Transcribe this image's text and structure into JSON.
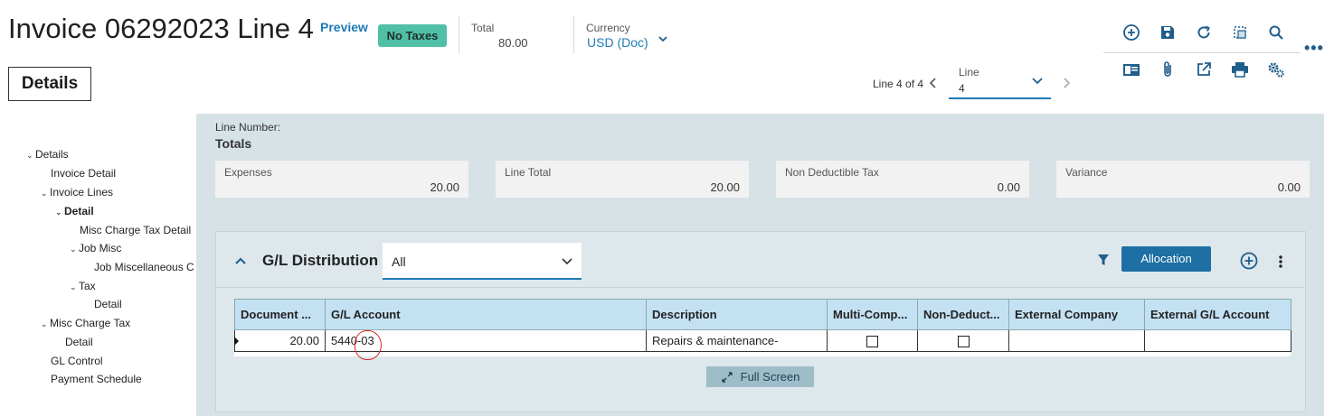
{
  "header": {
    "title": "Invoice 06292023 Line 4",
    "preview_link": "Preview",
    "tax_badge": "No Taxes",
    "total_label": "Total",
    "total_value": "80.00",
    "currency_label": "Currency",
    "currency_value": "USD (Doc)"
  },
  "toolbar": {
    "icons": [
      "add-icon",
      "save-icon",
      "refresh-icon",
      "select-area-icon",
      "search-icon",
      "card-view-icon",
      "attachment-icon",
      "open-external-icon",
      "print-icon",
      "settings-icon",
      "more-icon"
    ]
  },
  "tab": {
    "details_label": "Details"
  },
  "line_nav": {
    "position_text": "Line 4 of 4",
    "select_label": "Line",
    "select_value": "4"
  },
  "tree": {
    "items": [
      {
        "label": "Details",
        "caret": "v"
      },
      {
        "label": "Invoice Detail",
        "caret": ""
      },
      {
        "label": "Invoice Lines",
        "caret": "v"
      },
      {
        "label": "Detail",
        "caret": "v"
      },
      {
        "label": "Misc Charge Tax Detail",
        "caret": ""
      },
      {
        "label": "Job Misc",
        "caret": "v"
      },
      {
        "label": "Job Miscellaneous C",
        "caret": ""
      },
      {
        "label": "Tax",
        "caret": "v"
      },
      {
        "label": "Detail",
        "caret": ""
      },
      {
        "label": "Misc Charge Tax",
        "caret": "v"
      },
      {
        "label": "Detail",
        "caret": ""
      },
      {
        "label": "GL Control",
        "caret": ""
      },
      {
        "label": "Payment Schedule",
        "caret": ""
      }
    ]
  },
  "totals": {
    "line_number_label": "Line Number:",
    "heading": "Totals",
    "expenses_label": "Expenses",
    "expenses_value": "20.00",
    "line_total_label": "Line Total",
    "line_total_value": "20.00",
    "non_deductible_label": "Non Deductible Tax",
    "non_deductible_value": "0.00",
    "variance_label": "Variance",
    "variance_value": "0.00"
  },
  "gl": {
    "title": "G/L Distribution",
    "filter_value": "All",
    "allocation_label": "Allocation",
    "columns": [
      "Document ...",
      "G/L Account",
      "Description",
      "Multi-Comp...",
      "Non-Deduct...",
      "External Company",
      "External G/L Account"
    ],
    "row": {
      "document_amount": "20.00",
      "gl_account": "5440-03",
      "description": "Repairs & maintenance-",
      "external_company": "",
      "external_gl_account": ""
    },
    "fullscreen_label": "Full Screen"
  },
  "colors": {
    "accent": "#1f7ab5",
    "badge": "#4fbfa6",
    "header_row": "#c4e1f3",
    "panel": "#d7e2e7"
  }
}
